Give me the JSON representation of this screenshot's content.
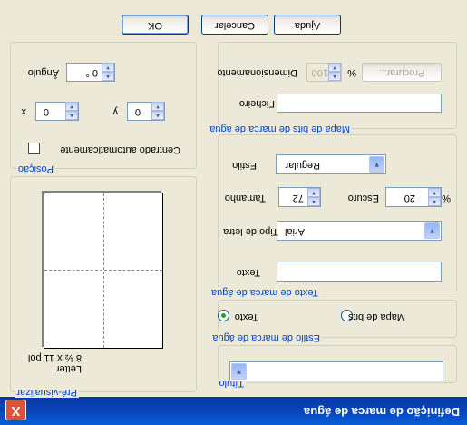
{
  "title": "Definição de marca de água",
  "close_symbol": "X",
  "groups": {
    "titulo": "Título",
    "estilo_marca": "Estilo de marca de água",
    "texto_marca": "Texto de marca de água",
    "mapa_bits": "Mapa de bits de marca de água",
    "posicao": "Posição",
    "pre_visualizar": "Pré-visualizar"
  },
  "titulo_value": "",
  "radio": {
    "texto": "Texto",
    "mapa_bits": "Mapa de bits",
    "selected": "texto"
  },
  "texto_marca": {
    "texto_label": "Texto",
    "texto_value": "",
    "fonte_label": "Tipo de letra",
    "fonte_value": "Arial",
    "tamanho_label": "Tamanho",
    "tamanho_value": "72",
    "escuro_label": "Escuro",
    "escuro_value": "20",
    "escuro_unit": "%",
    "estilo_label": "Estilo",
    "estilo_value": "Regular"
  },
  "mapa_bits": {
    "ficheiro_label": "Ficheiro",
    "ficheiro_value": "",
    "dim_label": "Dimensionamento",
    "dim_value": "100",
    "dim_unit": "%",
    "procurar_label": "Procurar..."
  },
  "posicao": {
    "centrado_label": "Centrado automaticamente",
    "x_label": "x",
    "x_value": "0",
    "y_label": "y",
    "y_value": "0",
    "angulo_label": "Ângulo",
    "angulo_value": "0 °"
  },
  "preview": {
    "paper": "Letter",
    "size": "8 ½ x 11 pol"
  },
  "buttons": {
    "ok": "OK",
    "cancelar": "Cancelar",
    "ajuda": "Ajuda"
  },
  "colors": {
    "titlebar": "#0a4fd0",
    "legend": "#0046d5",
    "close": "#e0503a"
  }
}
